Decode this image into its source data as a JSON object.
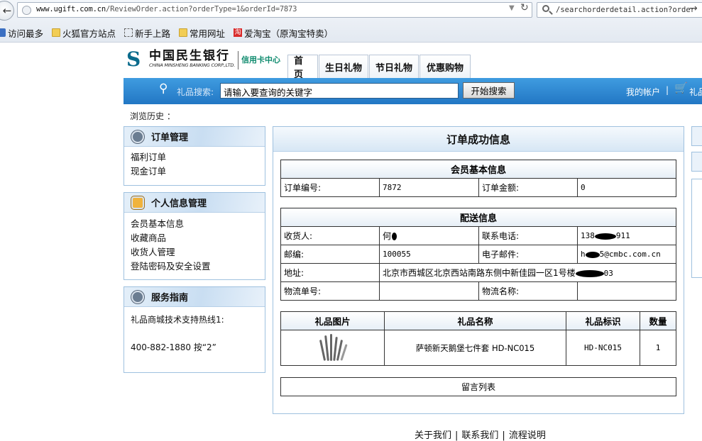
{
  "browser": {
    "url_host": "www.ugift.com.cn",
    "url_path": "/ReviewOrder.action?orderType=1&orderId=7873",
    "search_value": "/searchorderdetail.action?order",
    "bookmarks": [
      "访问最多",
      "火狐官方站点",
      "新手上路",
      "常用网址",
      "爱淘宝（原淘宝特卖）"
    ],
    "icons": [
      "back-arrow-icon",
      "globe-icon",
      "dropdown-icon",
      "reload-icon",
      "search-icon",
      "go-arrow-icon"
    ]
  },
  "site": {
    "logo_cn": "中国民生银行",
    "logo_en": "CHINA MINSHENG BANKING CORP.,LTD.",
    "logo_sub": "信用卡中心",
    "nav": [
      "首页",
      "生日礼物",
      "节日礼物",
      "优惠购物"
    ],
    "search_label": "礼品搜索:",
    "search_value": "请输入要查询的关键字",
    "search_button": "开始搜索",
    "my_account": "我的帐户",
    "separator": "|",
    "cart": "礼品",
    "history_label": "浏览历史 ："
  },
  "sidebar": {
    "order_mgmt": {
      "title": "订单管理",
      "items": [
        "福利订单",
        "现金订单"
      ]
    },
    "personal": {
      "title": "个人信息管理",
      "items": [
        "会员基本信息",
        "收藏商品",
        "收货人管理",
        "登陆密码及安全设置"
      ]
    },
    "service": {
      "title": "服务指南",
      "hotline": "礼品商城技术支持热线1:",
      "number": "400-882-1880 按“2”"
    }
  },
  "main": {
    "title": "订单成功信息",
    "member": {
      "title": "会员基本信息",
      "order_no_label": "订单编号:",
      "order_no": "7872",
      "amount_label": "订单金额:",
      "amount": "0"
    },
    "delivery": {
      "title": "配送信息",
      "receiver_label": "收货人:",
      "receiver": "何",
      "phone_label": "联系电话:",
      "phone_a": "138",
      "phone_b": "911",
      "zip_label": "邮编:",
      "zip": "100055",
      "email_label": "电子邮件:",
      "email_a": "h",
      "email_b": "5@cmbc.com.cn",
      "address_label": "地址:",
      "address_a": "北京市西城区北京西站南路东侧中新佳园一区1号楼",
      "address_b": "03",
      "logistics_no_label": "物流单号:",
      "logistics_no": "",
      "logistics_name_label": "物流名称:",
      "logistics_name": ""
    },
    "gifts": {
      "headers": [
        "礼品图片",
        "礼品名称",
        "礼品标识",
        "数量"
      ],
      "rows": [
        {
          "name": "萨顿新天鹅堡七件套 HD-NC015",
          "code": "HD-NC015",
          "qty": "1"
        }
      ]
    },
    "messages": "留言列表"
  },
  "footer": {
    "links": [
      "关于我们",
      "联系我们",
      "流程说明"
    ],
    "sep": "|"
  }
}
